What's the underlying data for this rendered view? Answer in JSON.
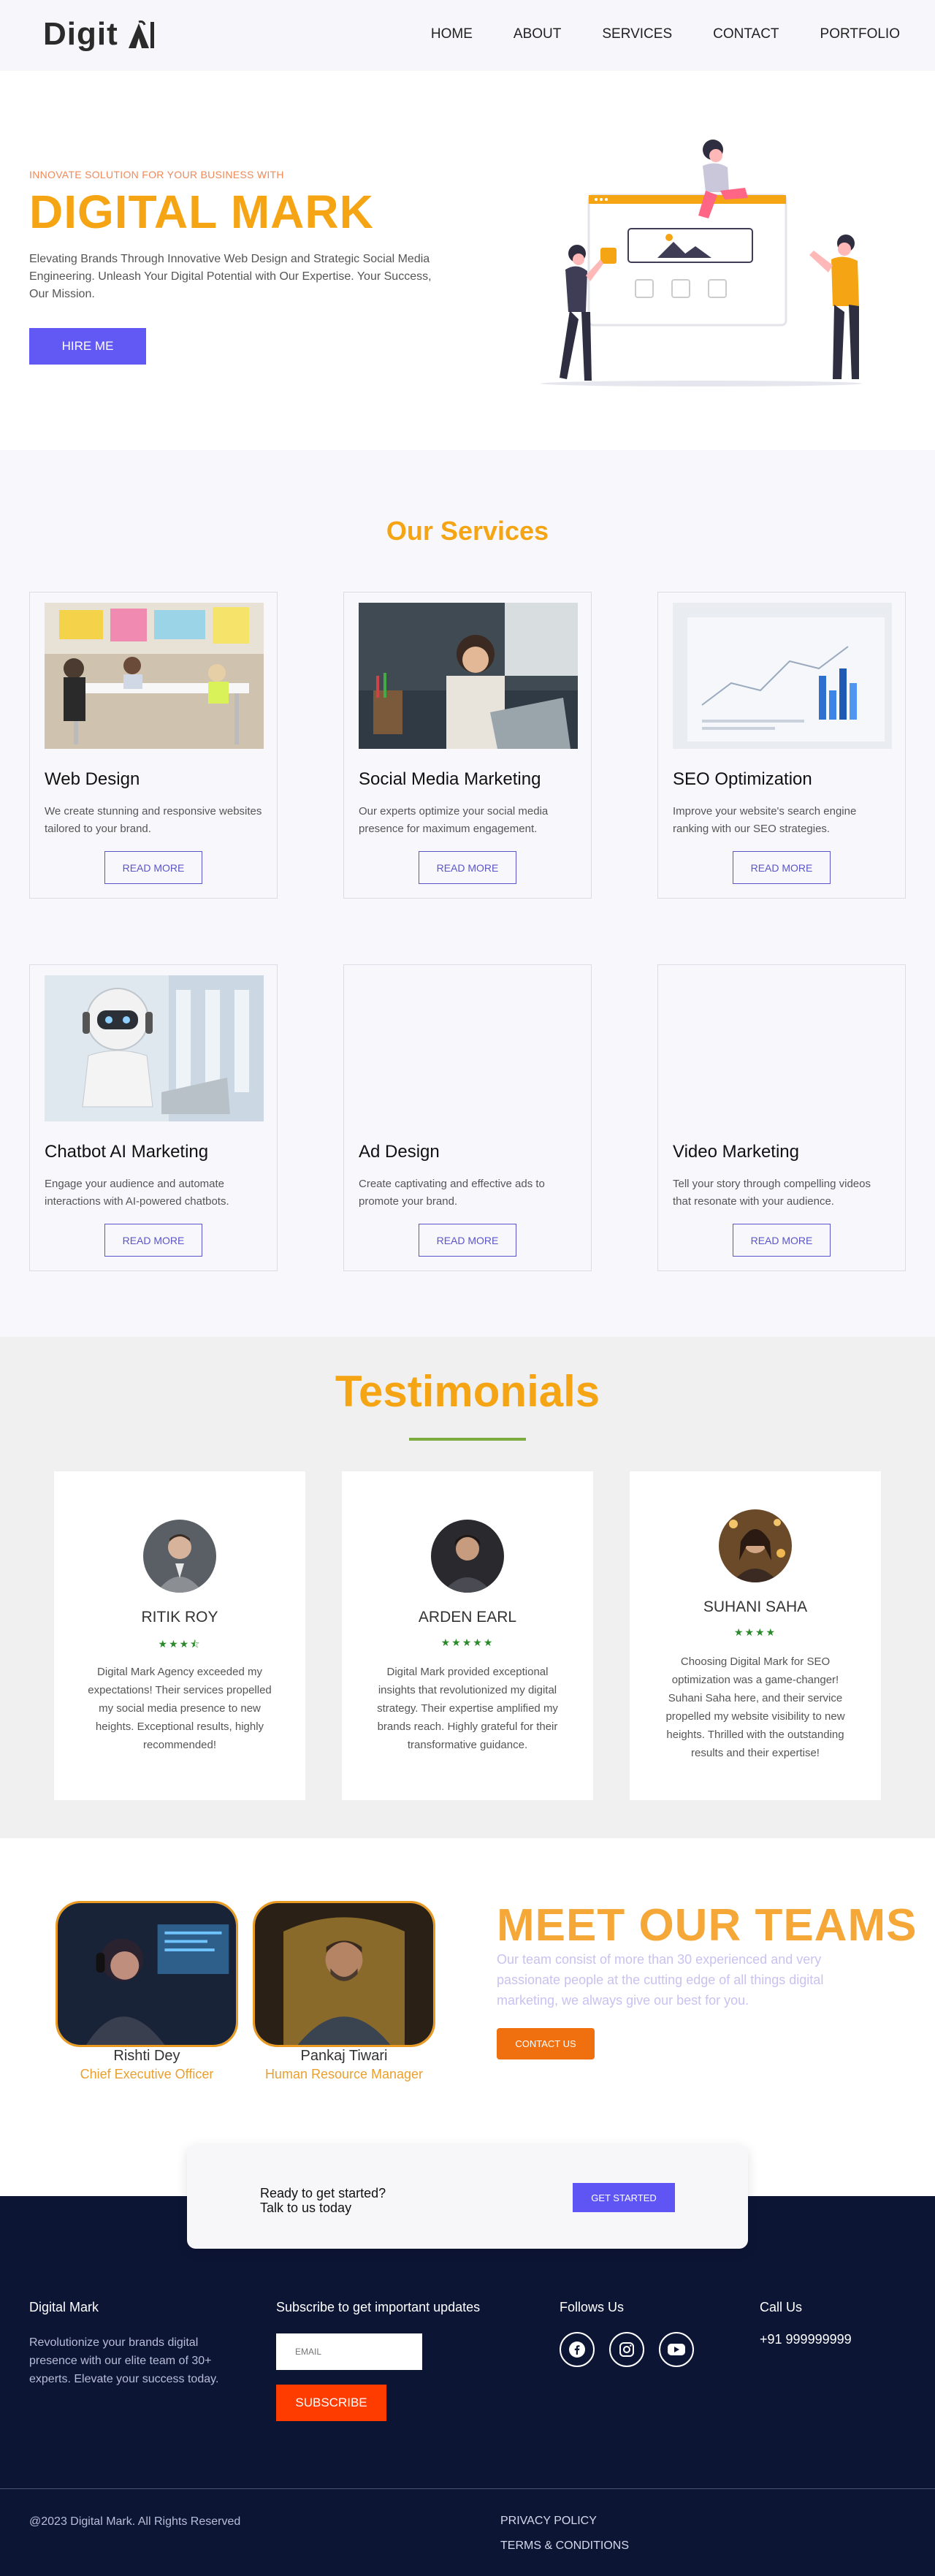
{
  "nav": {
    "logo_text": "Digit",
    "links": [
      "HOME",
      "ABOUT",
      "SERVICES",
      "CONTACT",
      "PORTFOLIO"
    ]
  },
  "hero": {
    "subtitle": "INNOVATE SOLUTION FOR YOUR BUSINESS WITH",
    "title": "DIGITAL MARK",
    "description": "Elevating Brands Through Innovative Web Design and Strategic Social Media Engineering. Unleash Your Digital Potential with Our Expertise. Your Success, Our Mission.",
    "cta_label": "HIRE ME"
  },
  "services": {
    "heading": "Our Services",
    "button_label": "READ MORE",
    "items": [
      {
        "title": "Web Design",
        "description": "We create stunning and responsive websites tailored to your brand."
      },
      {
        "title": "Social Media Marketing",
        "description": "Our experts optimize your social media presence for maximum engagement."
      },
      {
        "title": "SEO Optimization",
        "description": "Improve your website's search engine ranking with our SEO strategies."
      },
      {
        "title": "Chatbot AI Marketing",
        "description": "Engage your audience and automate interactions with AI-powered chatbots."
      },
      {
        "title": "Ad Design",
        "description": "Create captivating and effective ads to promote your brand."
      },
      {
        "title": "Video Marketing",
        "description": "Tell your story through compelling videos that resonate with your audience."
      }
    ]
  },
  "testimonials": {
    "heading": "Testimonials",
    "items": [
      {
        "name": "RITIK ROY",
        "stars": "★★★⯪",
        "rating": 3.5,
        "text": "Digital Mark Agency exceeded my expectations! Their services propelled my social media presence to new heights. Exceptional results, highly recommended!"
      },
      {
        "name": "ARDEN EARL",
        "stars": "★★★★★",
        "rating": 5,
        "text": "Digital Mark provided exceptional insights that revolutionized my digital strategy. Their expertise amplified my brands reach. Highly grateful for their transformative guidance."
      },
      {
        "name": "SUHANI SAHA",
        "stars": "★★★★",
        "rating": 4,
        "text": "Choosing Digital Mark for SEO optimization was a game-changer! Suhani Saha here, and their service propelled my website visibility to new heights. Thrilled with the outstanding results and their expertise!"
      }
    ]
  },
  "teams": {
    "heading": "MEET OUR TEAMS",
    "description": "Our team consist of more than 30 experienced and very passionate people at the cutting edge of all things digital marketing, we always give our best for you.",
    "cta_label": "CONTACT US",
    "members": [
      {
        "name": "Rishti Dey",
        "role": "Chief Executive Officer"
      },
      {
        "name": "Pankaj Tiwari",
        "role": "Human Resource Manager"
      }
    ]
  },
  "cta": {
    "line1": "Ready to get started?",
    "line2": "Talk to us today",
    "button_label": "GET STARTED"
  },
  "footer": {
    "brand": "Digital Mark",
    "about": "Revolutionize your brands digital presence with our elite team of 30+ experts. Elevate your success today.",
    "subscribe_heading": "Subscribe to get important updates",
    "email_placeholder": "EMAIL",
    "subscribe_label": "SUBSCRIBE",
    "follow_heading": "Follows Us",
    "social_icons": [
      "facebook-icon",
      "instagram-icon",
      "youtube-icon"
    ],
    "call_heading": "Call Us",
    "phone": "+91 999999999",
    "copyright": "@2023 Digital Mark. All Rights Reserved",
    "links": [
      "PRIVACY POLICY",
      "TERMS & CONDITIONS"
    ]
  },
  "colors": {
    "accent_orange": "#f5a514",
    "primary_purple": "#6259f5",
    "footer_bg": "#0d1535",
    "subscribe_red": "#ff3c00"
  }
}
